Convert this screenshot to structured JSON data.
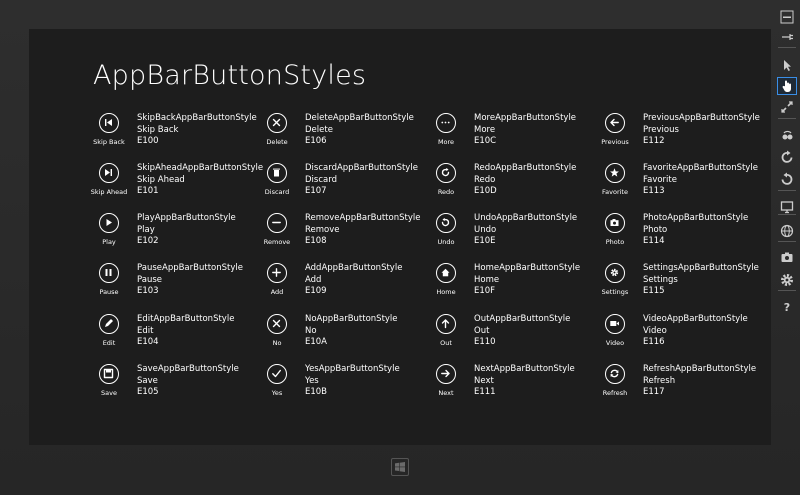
{
  "page_title": "AppBarButtonStyles",
  "columns": [
    [
      {
        "label": "Skip Back",
        "style": "SkipBackAppBarButtonStyle",
        "name": "Skip Back",
        "code": "E100",
        "icon": "skip-back-icon"
      },
      {
        "label": "Skip Ahead",
        "style": "SkipAheadAppBarButtonStyle",
        "name": "Skip Ahead",
        "code": "E101",
        "icon": "skip-ahead-icon"
      },
      {
        "label": "Play",
        "style": "PlayAppBarButtonStyle",
        "name": "Play",
        "code": "E102",
        "icon": "play-icon"
      },
      {
        "label": "Pause",
        "style": "PauseAppBarButtonStyle",
        "name": "Pause",
        "code": "E103",
        "icon": "pause-icon"
      },
      {
        "label": "Edit",
        "style": "EditAppBarButtonStyle",
        "name": "Edit",
        "code": "E104",
        "icon": "edit-icon"
      },
      {
        "label": "Save",
        "style": "SaveAppBarButtonStyle",
        "name": "Save",
        "code": "E105",
        "icon": "save-icon"
      }
    ],
    [
      {
        "label": "Delete",
        "style": "DeleteAppBarButtonStyle",
        "name": "Delete",
        "code": "E106",
        "icon": "delete-icon"
      },
      {
        "label": "Discard",
        "style": "DiscardAppBarButtonStyle",
        "name": "Discard",
        "code": "E107",
        "icon": "discard-icon"
      },
      {
        "label": "Remove",
        "style": "RemoveAppBarButtonStyle",
        "name": "Remove",
        "code": "E108",
        "icon": "remove-icon"
      },
      {
        "label": "Add",
        "style": "AddAppBarButtonStyle",
        "name": "Add",
        "code": "E109",
        "icon": "add-icon"
      },
      {
        "label": "No",
        "style": "NoAppBarButtonStyle",
        "name": "No",
        "code": "E10A",
        "icon": "no-icon"
      },
      {
        "label": "Yes",
        "style": "YesAppBarButtonStyle",
        "name": "Yes",
        "code": "E10B",
        "icon": "yes-icon"
      }
    ],
    [
      {
        "label": "More",
        "style": "MoreAppBarButtonStyle",
        "name": "More",
        "code": "E10C",
        "icon": "more-icon"
      },
      {
        "label": "Redo",
        "style": "RedoAppBarButtonStyle",
        "name": "Redo",
        "code": "E10D",
        "icon": "redo-icon"
      },
      {
        "label": "Undo",
        "style": "UndoAppBarButtonStyle",
        "name": "Undo",
        "code": "E10E",
        "icon": "undo-icon"
      },
      {
        "label": "Home",
        "style": "HomeAppBarButtonStyle",
        "name": "Home",
        "code": "E10F",
        "icon": "home-icon"
      },
      {
        "label": "Out",
        "style": "OutAppBarButtonStyle",
        "name": "Out",
        "code": "E110",
        "icon": "out-icon"
      },
      {
        "label": "Next",
        "style": "NextAppBarButtonStyle",
        "name": "Next",
        "code": "E111",
        "icon": "next-icon"
      }
    ],
    [
      {
        "label": "Previous",
        "style": "PreviousAppBarButtonStyle",
        "name": "Previous",
        "code": "E112",
        "icon": "previous-icon"
      },
      {
        "label": "Favorite",
        "style": "FavoriteAppBarButtonStyle",
        "name": "Favorite",
        "code": "E113",
        "icon": "favorite-icon"
      },
      {
        "label": "Photo",
        "style": "PhotoAppBarButtonStyle",
        "name": "Photo",
        "code": "E114",
        "icon": "photo-icon"
      },
      {
        "label": "Settings",
        "style": "SettingsAppBarButtonStyle",
        "name": "Settings",
        "code": "E115",
        "icon": "settings-icon"
      },
      {
        "label": "Video",
        "style": "VideoAppBarButtonStyle",
        "name": "Video",
        "code": "E116",
        "icon": "video-icon"
      },
      {
        "label": "Refresh",
        "style": "RefreshAppBarButtonStyle",
        "name": "Refresh",
        "code": "E117",
        "icon": "refresh-icon"
      }
    ]
  ],
  "sidebar_tools": [
    {
      "icon": "minimize-icon"
    },
    {
      "icon": "pin-icon"
    },
    {
      "icon": "mouse-pointer-icon"
    },
    {
      "icon": "touch-hand-icon",
      "active": true
    },
    {
      "icon": "pinch-zoom-icon"
    },
    {
      "icon": "rotate-touch-icon"
    },
    {
      "icon": "rotate-clockwise-icon"
    },
    {
      "icon": "rotate-counterclockwise-icon"
    },
    {
      "icon": "change-resolution-icon"
    },
    {
      "icon": "location-globe-icon"
    },
    {
      "icon": "screenshot-camera-icon"
    },
    {
      "icon": "settings-gear-icon"
    },
    {
      "icon": "help-icon"
    }
  ],
  "sidebar_help_glyph": "?",
  "colors": {
    "screen": "#1d1d1d",
    "bezel": "#2b2b2b",
    "text": "#ffffff",
    "active_border": "#3a8ee6"
  }
}
